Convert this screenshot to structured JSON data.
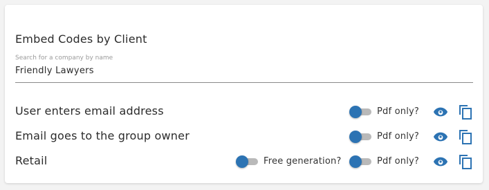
{
  "card": {
    "title": "Embed Codes by Client"
  },
  "search": {
    "label": "Search for a company by name",
    "value": "Friendly Lawyers"
  },
  "rows": [
    {
      "label": "User enters email address",
      "pdf_label": "Pdf only?",
      "pdf_only": false
    },
    {
      "label": "Email goes to the group owner",
      "pdf_label": "Pdf only?",
      "pdf_only": false
    },
    {
      "label": "Retail",
      "free_label": "Free generation?",
      "free_generation": false,
      "pdf_label": "Pdf only?",
      "pdf_only": false
    }
  ],
  "icons": {
    "view": "eye-icon",
    "copy": "copy-icon"
  },
  "colors": {
    "accent": "#2c73b3",
    "toggle_track": "#b9b9b9",
    "text": "#2b2b2b"
  }
}
